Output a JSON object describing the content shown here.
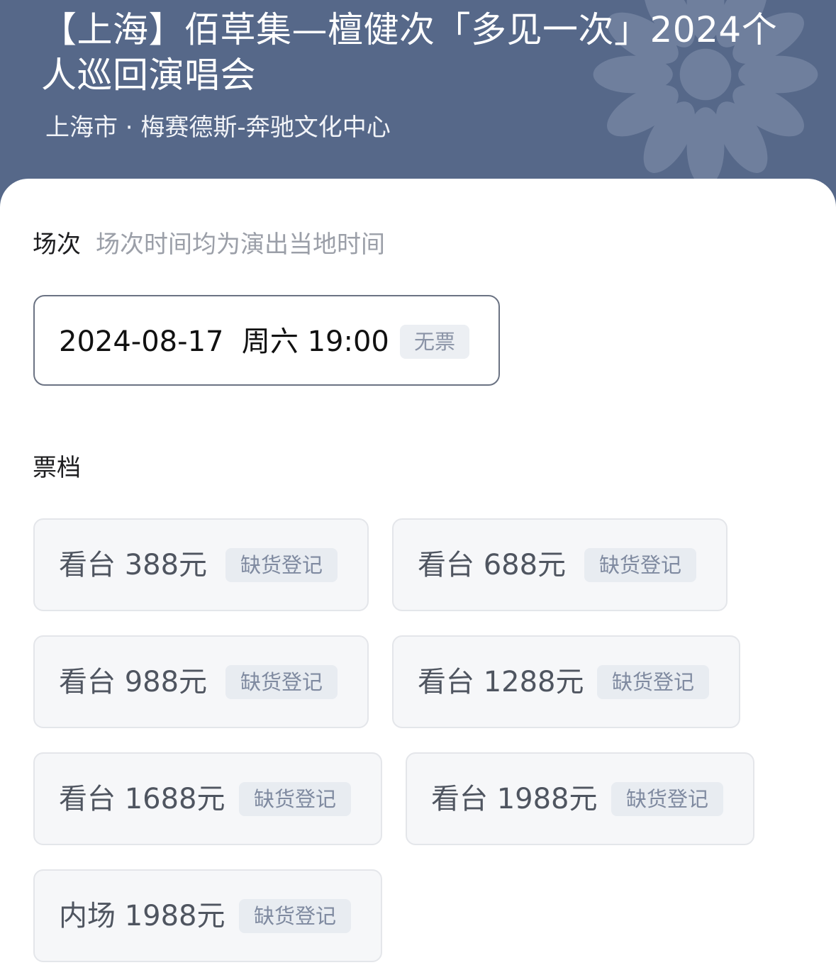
{
  "header": {
    "title": "【上海】佰草集—檀健次「多见一次」2024个人巡回演唱会",
    "venue": "上海市 · 梅赛德斯-奔驰文化中心"
  },
  "session_section": {
    "label": "场次",
    "hint": "场次时间均为演出当地时间",
    "session": {
      "datetime": "2024-08-17  周六 19:00",
      "status": "无票"
    }
  },
  "tier_section": {
    "label": "票档",
    "tiers": [
      {
        "name": "看台 388元",
        "status": "缺货登记"
      },
      {
        "name": "看台 688元",
        "status": "缺货登记"
      },
      {
        "name": "看台 988元",
        "status": "缺货登记"
      },
      {
        "name": "看台 1288元",
        "status": "缺货登记"
      },
      {
        "name": "看台 1688元",
        "status": "缺货登记"
      },
      {
        "name": "看台 1988元",
        "status": "缺货登记"
      },
      {
        "name": "内场 1988元",
        "status": "缺货登记"
      }
    ]
  },
  "colors": {
    "header_bg": "#566889",
    "session_border": "#6b7383",
    "tier_bg": "#f6f7f9",
    "badge_bg": "#e8ecf1"
  }
}
